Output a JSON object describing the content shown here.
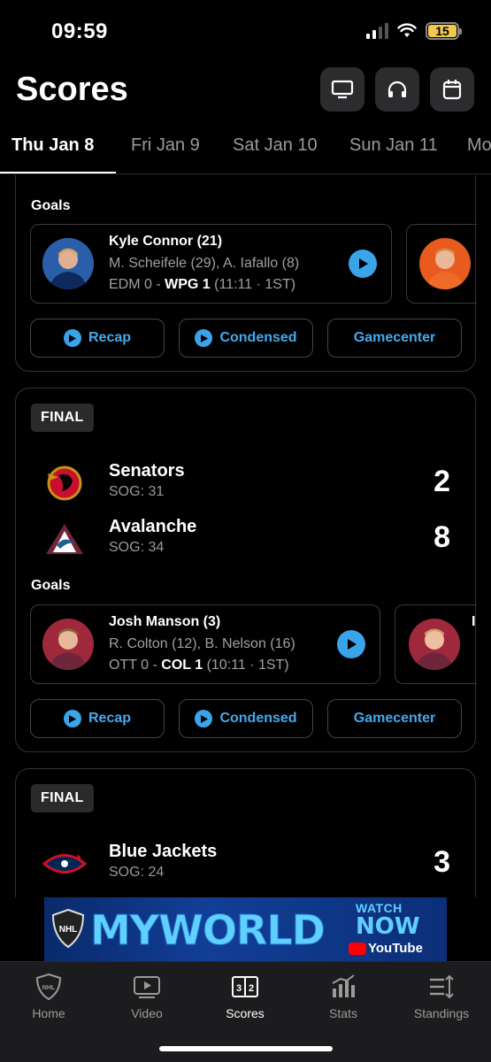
{
  "status_bar": {
    "time": "09:59",
    "battery": "15",
    "battery_color": "#f2c94c"
  },
  "header": {
    "title": "Scores",
    "icons": [
      "tv-icon",
      "headphones-icon",
      "calendar-icon"
    ]
  },
  "date_tabs": [
    "Thu Jan 8",
    "Fri Jan 9",
    "Sat Jan 10",
    "Sun Jan 11",
    "Mo"
  ],
  "game1": {
    "goals_label": "Goals",
    "goal": {
      "scorer": "Kyle Connor (21)",
      "assists": "M. Scheifele (29), A. Iafallo (8)",
      "away": "EDM 0",
      "sep": "-",
      "home": "WPG 1",
      "time": "(11:11 · 1ST)"
    },
    "buttons": {
      "recap": "Recap",
      "condensed": "Condensed",
      "gamecenter": "Gamecenter"
    }
  },
  "game2": {
    "status": "FINAL",
    "teams": [
      {
        "name": "Senators",
        "sog": "SOG: 31",
        "score": "2"
      },
      {
        "name": "Avalanche",
        "sog": "SOG: 34",
        "score": "8"
      }
    ],
    "goals_label": "Goals",
    "goal": {
      "scorer": "Josh Manson (3)",
      "assists": "R. Colton (12), B. Nelson (16)",
      "away": "OTT 0",
      "sep": "-",
      "home": "COL 1",
      "time": "(10:11 · 1ST)"
    },
    "peek_text": "I",
    "buttons": {
      "recap": "Recap",
      "condensed": "Condensed",
      "gamecenter": "Gamecenter"
    }
  },
  "game3": {
    "status": "FINAL",
    "teams": [
      {
        "name": "Blue Jackets",
        "sog": "SOG: 24",
        "score": "3"
      }
    ]
  },
  "banner": {
    "main": "MYWORLD",
    "watch": "WATCH",
    "now": "NOW",
    "youtube": "YouTube"
  },
  "bottom_nav": [
    {
      "label": "Home",
      "icon": "nhl-shield-icon"
    },
    {
      "label": "Video",
      "icon": "video-play-icon"
    },
    {
      "label": "Scores",
      "icon": "scoreboard-icon"
    },
    {
      "label": "Stats",
      "icon": "bar-chart-icon"
    },
    {
      "label": "Standings",
      "icon": "standings-list-icon"
    }
  ],
  "colors": {
    "accent": "#3ba3e8",
    "link": "#45a9ef",
    "card_border": "#333333"
  }
}
